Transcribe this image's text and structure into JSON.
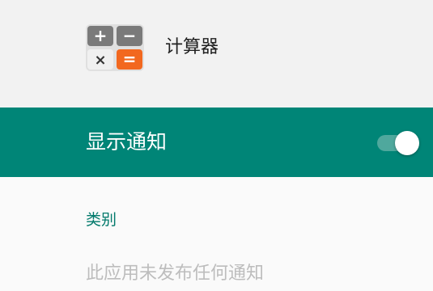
{
  "app": {
    "name": "计算器",
    "icon": "calculator-icon",
    "icon_keys": [
      "+",
      "−",
      "×",
      "="
    ]
  },
  "notifications": {
    "master_label": "显示通知",
    "master_enabled": true
  },
  "section": {
    "title": "类别"
  },
  "empty_state": {
    "text": "此应用未发布任何通知"
  },
  "colors": {
    "accent": "#008577",
    "section_title": "#00796b",
    "header_bg": "#f2f2f2",
    "page_bg": "#fafafa",
    "muted_text": "#bdbdbd",
    "icon_key_gray": "#7a7a7a",
    "icon_key_light": "#f0f0f0",
    "icon_key_orange": "#f2681f"
  }
}
